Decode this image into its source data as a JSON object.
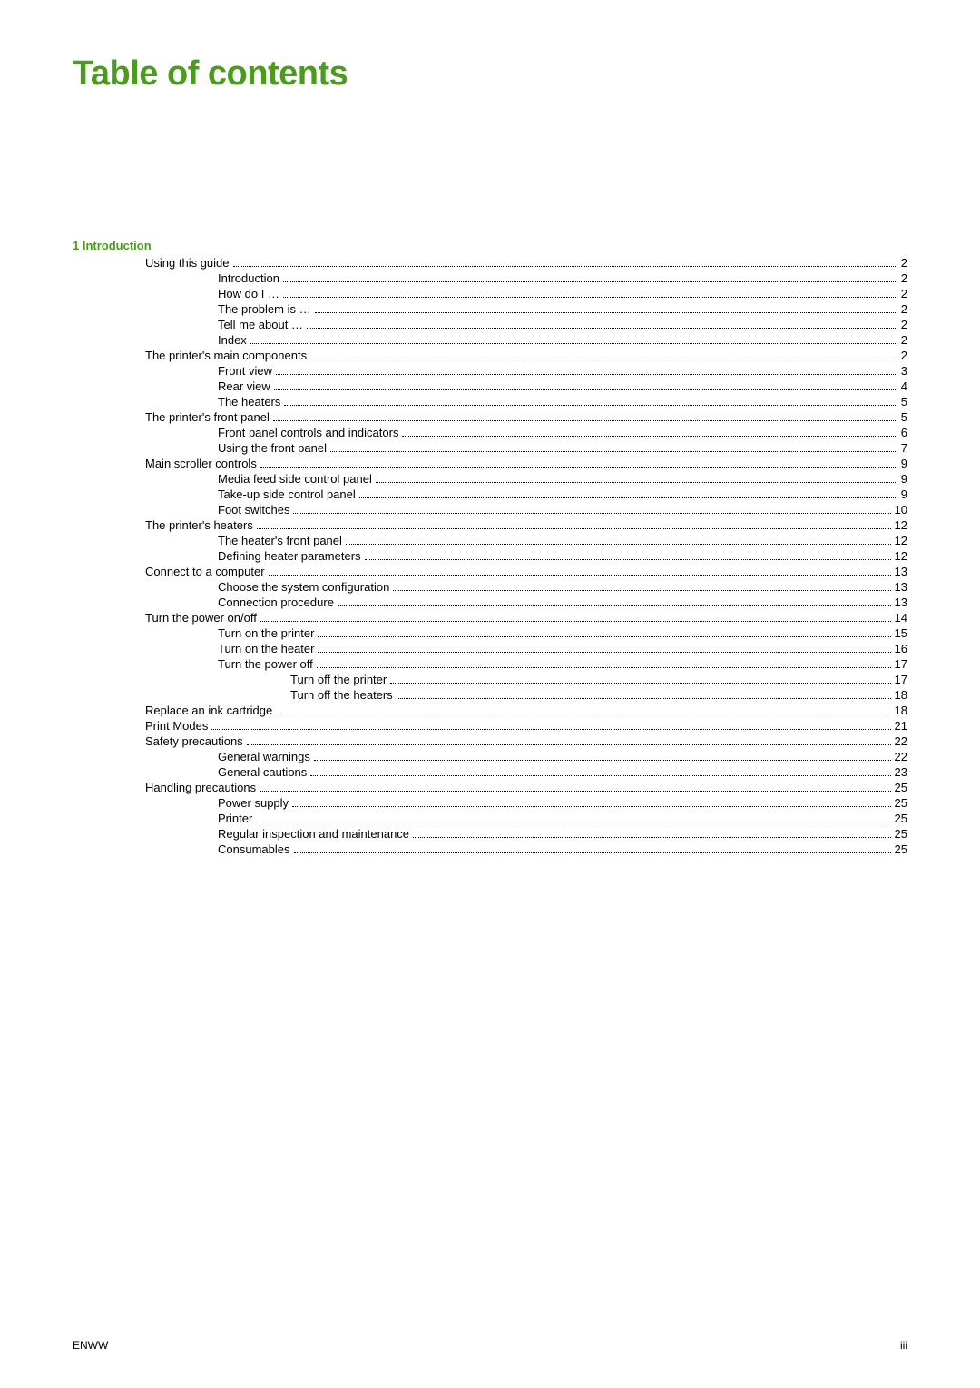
{
  "header": {
    "title": "Table of contents"
  },
  "section1": {
    "label": "1  Introduction"
  },
  "entries": [
    {
      "indent": 1,
      "text": "Using this guide",
      "page": "2"
    },
    {
      "indent": 2,
      "text": "Introduction",
      "page": "2"
    },
    {
      "indent": 2,
      "text": "How do I …",
      "page": "2"
    },
    {
      "indent": 2,
      "text": "The problem is …",
      "page": "2"
    },
    {
      "indent": 2,
      "text": "Tell me about …",
      "page": "2"
    },
    {
      "indent": 2,
      "text": "Index",
      "page": "2"
    },
    {
      "indent": 1,
      "text": "The printer's main components",
      "page": "2"
    },
    {
      "indent": 2,
      "text": "Front view",
      "page": "3"
    },
    {
      "indent": 2,
      "text": "Rear view",
      "page": "4"
    },
    {
      "indent": 2,
      "text": "The heaters",
      "page": "5"
    },
    {
      "indent": 1,
      "text": "The printer's front panel",
      "page": "5"
    },
    {
      "indent": 2,
      "text": "Front panel controls and indicators",
      "page": "6"
    },
    {
      "indent": 2,
      "text": "Using the front panel",
      "page": "7"
    },
    {
      "indent": 1,
      "text": "Main scroller controls",
      "page": "9"
    },
    {
      "indent": 2,
      "text": "Media feed side control panel",
      "page": "9"
    },
    {
      "indent": 2,
      "text": "Take-up side control panel",
      "page": "9"
    },
    {
      "indent": 2,
      "text": "Foot switches",
      "page": "10"
    },
    {
      "indent": 1,
      "text": "The printer's heaters",
      "page": "12"
    },
    {
      "indent": 2,
      "text": "The heater's front panel",
      "page": "12"
    },
    {
      "indent": 2,
      "text": "Defining heater parameters",
      "page": "12"
    },
    {
      "indent": 1,
      "text": "Connect to a computer",
      "page": "13"
    },
    {
      "indent": 2,
      "text": "Choose the system configuration",
      "page": "13"
    },
    {
      "indent": 2,
      "text": "Connection procedure",
      "page": "13"
    },
    {
      "indent": 1,
      "text": "Turn the power on/off",
      "page": "14"
    },
    {
      "indent": 2,
      "text": "Turn on the printer",
      "page": "15"
    },
    {
      "indent": 2,
      "text": "Turn on the heater",
      "page": "16"
    },
    {
      "indent": 2,
      "text": "Turn the power off",
      "page": "17"
    },
    {
      "indent": 3,
      "text": "Turn off the printer",
      "page": "17"
    },
    {
      "indent": 3,
      "text": "Turn off the heaters",
      "page": "18"
    },
    {
      "indent": 1,
      "text": "Replace an ink cartridge",
      "page": "18"
    },
    {
      "indent": 1,
      "text": "Print Modes",
      "page": "21"
    },
    {
      "indent": 1,
      "text": "Safety precautions",
      "page": "22"
    },
    {
      "indent": 2,
      "text": "General warnings",
      "page": "22"
    },
    {
      "indent": 2,
      "text": "General cautions",
      "page": "23"
    },
    {
      "indent": 1,
      "text": "Handling precautions",
      "page": "25"
    },
    {
      "indent": 2,
      "text": "Power supply",
      "page": "25"
    },
    {
      "indent": 2,
      "text": "Printer",
      "page": "25"
    },
    {
      "indent": 2,
      "text": "Regular inspection and maintenance",
      "page": "25"
    },
    {
      "indent": 2,
      "text": "Consumables",
      "page": "25"
    }
  ],
  "footer": {
    "left": "ENWW",
    "right": "iii"
  }
}
